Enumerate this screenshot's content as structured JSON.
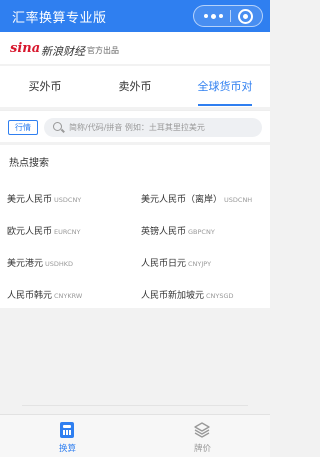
{
  "app": {
    "title": "汇率换算专业版"
  },
  "brand": {
    "logo_text": "sina",
    "logo_cn": "新浪财经",
    "official": "官方出品"
  },
  "tabs": [
    {
      "label": "买外币",
      "active": false
    },
    {
      "label": "卖外币",
      "active": false
    },
    {
      "label": "全球货币对",
      "active": true
    }
  ],
  "search": {
    "chip": "行情",
    "placeholder": "简称/代码/拼音  例如：土耳其里拉美元"
  },
  "hot": {
    "title": "热点搜索",
    "pairs": [
      {
        "name": "美元人民币",
        "code": "USDCNY"
      },
      {
        "name": "美元人民币（离岸）",
        "code": "USDCNH"
      },
      {
        "name": "欧元人民币",
        "code": "EURCNY"
      },
      {
        "name": "英镑人民币",
        "code": "GBPCNY"
      },
      {
        "name": "美元港元",
        "code": "USDHKD"
      },
      {
        "name": "人民币日元",
        "code": "CNYJPY"
      },
      {
        "name": "人民币韩元",
        "code": "CNYKRW"
      },
      {
        "name": "人民币新加坡元",
        "code": "CNYSGD"
      }
    ]
  },
  "tabbar": [
    {
      "label": "换算",
      "icon": "calculator-icon",
      "active": true
    },
    {
      "label": "牌价",
      "icon": "layers-icon",
      "active": false
    }
  ],
  "colors": {
    "accent": "#2f7ff0",
    "brand_red": "#d7172d"
  }
}
